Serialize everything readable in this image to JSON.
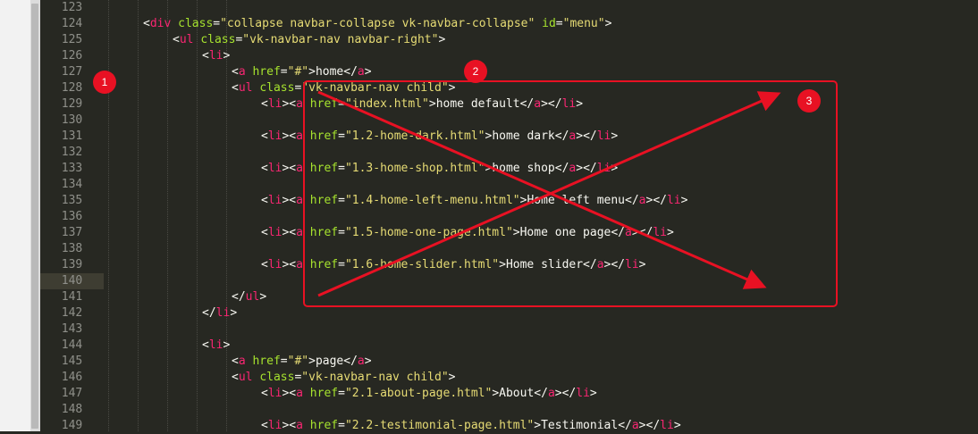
{
  "editor": {
    "current_line": 140,
    "lines": [
      {
        "n": "123",
        "indent": 0,
        "tokens": []
      },
      {
        "n": "124",
        "indent": 1,
        "tokens": [
          [
            "t-punc",
            "<"
          ],
          [
            "t-tag",
            "div"
          ],
          [
            "t-punc",
            " "
          ],
          [
            "t-attr",
            "class"
          ],
          [
            "t-punc",
            "="
          ],
          [
            "t-str",
            "\"collapse navbar-collapse vk-navbar-collapse\""
          ],
          [
            "t-punc",
            " "
          ],
          [
            "t-attr",
            "id"
          ],
          [
            "t-punc",
            "="
          ],
          [
            "t-str",
            "\"menu\""
          ],
          [
            "t-punc",
            ">"
          ]
        ]
      },
      {
        "n": "125",
        "indent": 2,
        "tokens": [
          [
            "t-punc",
            "<"
          ],
          [
            "t-tag",
            "ul"
          ],
          [
            "t-punc",
            " "
          ],
          [
            "t-attr",
            "class"
          ],
          [
            "t-punc",
            "="
          ],
          [
            "t-str",
            "\"vk-navbar-nav navbar-right\""
          ],
          [
            "t-punc",
            ">"
          ]
        ]
      },
      {
        "n": "126",
        "indent": 3,
        "tokens": [
          [
            "t-punc",
            "<"
          ],
          [
            "t-tag",
            "li"
          ],
          [
            "t-punc",
            ">"
          ]
        ]
      },
      {
        "n": "127",
        "indent": 4,
        "tokens": [
          [
            "t-punc",
            "<"
          ],
          [
            "t-tag",
            "a"
          ],
          [
            "t-punc",
            " "
          ],
          [
            "t-attr",
            "href"
          ],
          [
            "t-punc",
            "="
          ],
          [
            "t-str",
            "\"#\""
          ],
          [
            "t-punc",
            ">"
          ],
          [
            "t-text",
            "home"
          ],
          [
            "t-punc",
            "</"
          ],
          [
            "t-tag",
            "a"
          ],
          [
            "t-punc",
            ">"
          ]
        ]
      },
      {
        "n": "128",
        "indent": 4,
        "tokens": [
          [
            "t-punc",
            "<"
          ],
          [
            "t-tag",
            "ul"
          ],
          [
            "t-punc",
            " "
          ],
          [
            "t-attr",
            "class"
          ],
          [
            "t-punc",
            "="
          ],
          [
            "t-str",
            "\"vk-navbar-nav child\""
          ],
          [
            "t-punc",
            ">"
          ]
        ]
      },
      {
        "n": "129",
        "indent": 5,
        "tokens": [
          [
            "t-punc",
            "<"
          ],
          [
            "t-tag",
            "li"
          ],
          [
            "t-punc",
            "><"
          ],
          [
            "t-tag",
            "a"
          ],
          [
            "t-punc",
            " "
          ],
          [
            "t-attr",
            "href"
          ],
          [
            "t-punc",
            "="
          ],
          [
            "t-str",
            "\"index.html\""
          ],
          [
            "t-punc",
            ">"
          ],
          [
            "t-text",
            "home default"
          ],
          [
            "t-punc",
            "</"
          ],
          [
            "t-tag",
            "a"
          ],
          [
            "t-punc",
            "></"
          ],
          [
            "t-tag",
            "li"
          ],
          [
            "t-punc",
            ">"
          ]
        ]
      },
      {
        "n": "130",
        "indent": 0,
        "tokens": []
      },
      {
        "n": "131",
        "indent": 5,
        "tokens": [
          [
            "t-punc",
            "<"
          ],
          [
            "t-tag",
            "li"
          ],
          [
            "t-punc",
            "><"
          ],
          [
            "t-tag",
            "a"
          ],
          [
            "t-punc",
            " "
          ],
          [
            "t-attr",
            "href"
          ],
          [
            "t-punc",
            "="
          ],
          [
            "t-str",
            "\"1.2-home-dark.html\""
          ],
          [
            "t-punc",
            ">"
          ],
          [
            "t-text",
            "home dark"
          ],
          [
            "t-punc",
            "</"
          ],
          [
            "t-tag",
            "a"
          ],
          [
            "t-punc",
            "></"
          ],
          [
            "t-tag",
            "li"
          ],
          [
            "t-punc",
            ">"
          ]
        ]
      },
      {
        "n": "132",
        "indent": 0,
        "tokens": []
      },
      {
        "n": "133",
        "indent": 5,
        "tokens": [
          [
            "t-punc",
            "<"
          ],
          [
            "t-tag",
            "li"
          ],
          [
            "t-punc",
            "><"
          ],
          [
            "t-tag",
            "a"
          ],
          [
            "t-punc",
            " "
          ],
          [
            "t-attr",
            "href"
          ],
          [
            "t-punc",
            "="
          ],
          [
            "t-str",
            "\"1.3-home-shop.html\""
          ],
          [
            "t-punc",
            ">"
          ],
          [
            "t-text",
            "home shop"
          ],
          [
            "t-punc",
            "</"
          ],
          [
            "t-tag",
            "a"
          ],
          [
            "t-punc",
            "></"
          ],
          [
            "t-tag",
            "li"
          ],
          [
            "t-punc",
            ">"
          ]
        ]
      },
      {
        "n": "134",
        "indent": 0,
        "tokens": []
      },
      {
        "n": "135",
        "indent": 5,
        "tokens": [
          [
            "t-punc",
            "<"
          ],
          [
            "t-tag",
            "li"
          ],
          [
            "t-punc",
            "><"
          ],
          [
            "t-tag",
            "a"
          ],
          [
            "t-punc",
            " "
          ],
          [
            "t-attr",
            "href"
          ],
          [
            "t-punc",
            "="
          ],
          [
            "t-str",
            "\"1.4-home-left-menu.html\""
          ],
          [
            "t-punc",
            ">"
          ],
          [
            "t-text",
            "Home left menu"
          ],
          [
            "t-punc",
            "</"
          ],
          [
            "t-tag",
            "a"
          ],
          [
            "t-punc",
            "></"
          ],
          [
            "t-tag",
            "li"
          ],
          [
            "t-punc",
            ">"
          ]
        ]
      },
      {
        "n": "136",
        "indent": 0,
        "tokens": []
      },
      {
        "n": "137",
        "indent": 5,
        "tokens": [
          [
            "t-punc",
            "<"
          ],
          [
            "t-tag",
            "li"
          ],
          [
            "t-punc",
            "><"
          ],
          [
            "t-tag",
            "a"
          ],
          [
            "t-punc",
            " "
          ],
          [
            "t-attr",
            "href"
          ],
          [
            "t-punc",
            "="
          ],
          [
            "t-str",
            "\"1.5-home-one-page.html\""
          ],
          [
            "t-punc",
            ">"
          ],
          [
            "t-text",
            "Home one page"
          ],
          [
            "t-punc",
            "</"
          ],
          [
            "t-tag",
            "a"
          ],
          [
            "t-punc",
            "></"
          ],
          [
            "t-tag",
            "li"
          ],
          [
            "t-punc",
            ">"
          ]
        ]
      },
      {
        "n": "138",
        "indent": 0,
        "tokens": []
      },
      {
        "n": "139",
        "indent": 5,
        "tokens": [
          [
            "t-punc",
            "<"
          ],
          [
            "t-tag",
            "li"
          ],
          [
            "t-punc",
            "><"
          ],
          [
            "t-tag",
            "a"
          ],
          [
            "t-punc",
            " "
          ],
          [
            "t-attr",
            "href"
          ],
          [
            "t-punc",
            "="
          ],
          [
            "t-str",
            "\"1.6-home-slider.html\""
          ],
          [
            "t-punc",
            ">"
          ],
          [
            "t-text",
            "Home slider"
          ],
          [
            "t-punc",
            "</"
          ],
          [
            "t-tag",
            "a"
          ],
          [
            "t-punc",
            "></"
          ],
          [
            "t-tag",
            "li"
          ],
          [
            "t-punc",
            ">"
          ]
        ]
      },
      {
        "n": "140",
        "indent": 0,
        "tokens": []
      },
      {
        "n": "141",
        "indent": 4,
        "tokens": [
          [
            "t-punc",
            "</"
          ],
          [
            "t-tag",
            "ul"
          ],
          [
            "t-punc",
            ">"
          ]
        ]
      },
      {
        "n": "142",
        "indent": 3,
        "tokens": [
          [
            "t-punc",
            "</"
          ],
          [
            "t-tag",
            "li"
          ],
          [
            "t-punc",
            ">"
          ]
        ]
      },
      {
        "n": "143",
        "indent": 0,
        "tokens": []
      },
      {
        "n": "144",
        "indent": 3,
        "tokens": [
          [
            "t-punc",
            "<"
          ],
          [
            "t-tag",
            "li"
          ],
          [
            "t-punc",
            ">"
          ]
        ]
      },
      {
        "n": "145",
        "indent": 4,
        "tokens": [
          [
            "t-punc",
            "<"
          ],
          [
            "t-tag",
            "a"
          ],
          [
            "t-punc",
            " "
          ],
          [
            "t-attr",
            "href"
          ],
          [
            "t-punc",
            "="
          ],
          [
            "t-str",
            "\"#\""
          ],
          [
            "t-punc",
            ">"
          ],
          [
            "t-text",
            "page"
          ],
          [
            "t-punc",
            "</"
          ],
          [
            "t-tag",
            "a"
          ],
          [
            "t-punc",
            ">"
          ]
        ]
      },
      {
        "n": "146",
        "indent": 4,
        "tokens": [
          [
            "t-punc",
            "<"
          ],
          [
            "t-tag",
            "ul"
          ],
          [
            "t-punc",
            " "
          ],
          [
            "t-attr",
            "class"
          ],
          [
            "t-punc",
            "="
          ],
          [
            "t-str",
            "\"vk-navbar-nav child\""
          ],
          [
            "t-punc",
            ">"
          ]
        ]
      },
      {
        "n": "147",
        "indent": 5,
        "tokens": [
          [
            "t-punc",
            "<"
          ],
          [
            "t-tag",
            "li"
          ],
          [
            "t-punc",
            "><"
          ],
          [
            "t-tag",
            "a"
          ],
          [
            "t-punc",
            " "
          ],
          [
            "t-attr",
            "href"
          ],
          [
            "t-punc",
            "="
          ],
          [
            "t-str",
            "\"2.1-about-page.html\""
          ],
          [
            "t-punc",
            ">"
          ],
          [
            "t-text",
            "About"
          ],
          [
            "t-punc",
            "</"
          ],
          [
            "t-tag",
            "a"
          ],
          [
            "t-punc",
            "></"
          ],
          [
            "t-tag",
            "li"
          ],
          [
            "t-punc",
            ">"
          ]
        ]
      },
      {
        "n": "148",
        "indent": 0,
        "tokens": []
      },
      {
        "n": "149",
        "indent": 5,
        "tokens": [
          [
            "t-punc",
            "<"
          ],
          [
            "t-tag",
            "li"
          ],
          [
            "t-punc",
            "><"
          ],
          [
            "t-tag",
            "a"
          ],
          [
            "t-punc",
            " "
          ],
          [
            "t-attr",
            "href"
          ],
          [
            "t-punc",
            "="
          ],
          [
            "t-str",
            "\"2.2-testimonial-page.html\""
          ],
          [
            "t-punc",
            ">"
          ],
          [
            "t-text",
            "Testimonial"
          ],
          [
            "t-punc",
            "</"
          ],
          [
            "t-tag",
            "a"
          ],
          [
            "t-punc",
            "></"
          ],
          [
            "t-tag",
            "li"
          ],
          [
            "t-punc",
            ">"
          ]
        ]
      }
    ]
  },
  "annotations": {
    "color": "#e81123",
    "badges": [
      "1",
      "2",
      "3"
    ]
  }
}
